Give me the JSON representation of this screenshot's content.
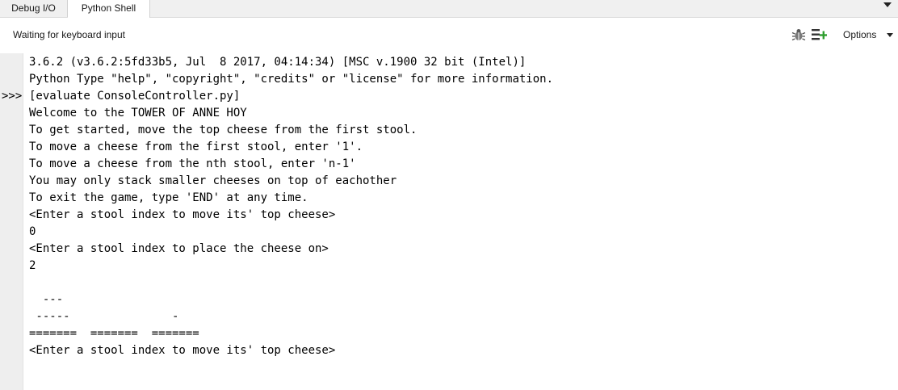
{
  "tabs": [
    {
      "label": "Debug I/O",
      "active": false
    },
    {
      "label": "Python Shell",
      "active": true
    }
  ],
  "status": {
    "text": "Waiting for keyboard input",
    "options_label": "Options"
  },
  "icons": {
    "debug": "bug-icon",
    "add": "add-list-icon",
    "tab_menu": "chevron-down-icon",
    "options": "chevron-down-icon"
  },
  "colors": {
    "add_icon_green": "#2e9e2e",
    "gutter": "#eeeeee",
    "tabbar": "#f0f0f0"
  },
  "console": {
    "prompt": ">>>",
    "prompt_line": 2,
    "lines": [
      "3.6.2 (v3.6.2:5fd33b5, Jul  8 2017, 04:14:34) [MSC v.1900 32 bit (Intel)]",
      "Python Type \"help\", \"copyright\", \"credits\" or \"license\" for more information.",
      "[evaluate ConsoleController.py]",
      "Welcome to the TOWER OF ANNE HOY",
      "To get started, move the top cheese from the first stool.",
      "To move a cheese from the first stool, enter '1'.",
      "To move a cheese from the nth stool, enter 'n-1'",
      "You may only stack smaller cheeses on top of eachother",
      "To exit the game, type 'END' at any time.",
      "<Enter a stool index to move its' top cheese>",
      "0",
      "<Enter a stool index to place the cheese on>",
      "2",
      "",
      "  ---",
      " -----               -",
      "=======  =======  =======",
      "<Enter a stool index to move its' top cheese>"
    ]
  }
}
